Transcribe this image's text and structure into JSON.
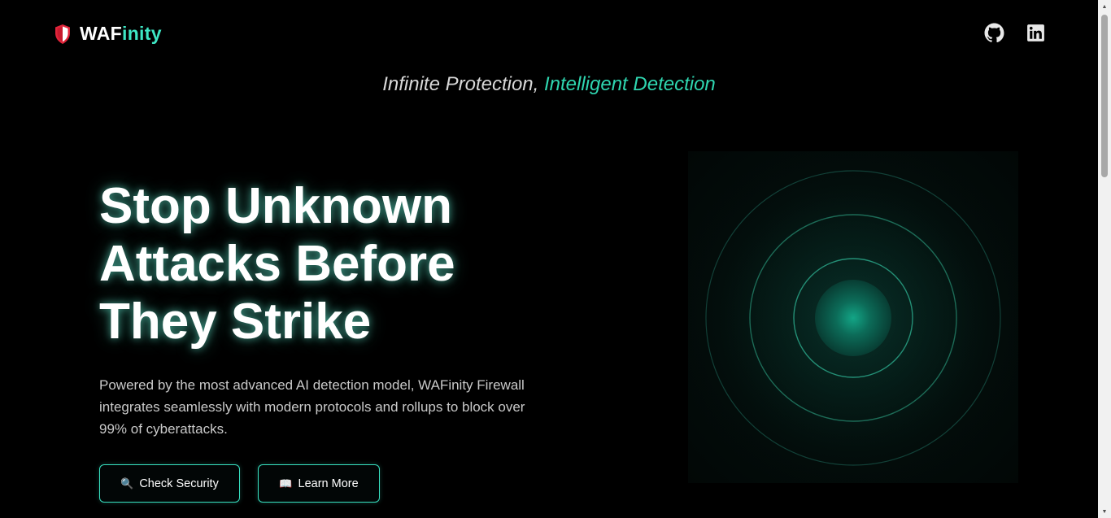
{
  "brand": {
    "name_part1": "WAF",
    "name_part2": "inity",
    "logo_icon": "shield-logo-icon"
  },
  "nav": {
    "icons": [
      "github-icon",
      "linkedin-icon"
    ]
  },
  "tagline": {
    "part1": "Infinite Protection, ",
    "part2": "Intelligent Detection"
  },
  "hero": {
    "title_lines": [
      "Stop Unknown",
      "Attacks Before",
      "They Strike"
    ],
    "description": "Powered by the most advanced AI detection model, WAFinity Firewall integrates seamlessly with modern protocols and rollups to block over 99% of cyberattacks.",
    "buttons": [
      {
        "icon": "🔍",
        "label": "Check Security"
      },
      {
        "icon": "📖",
        "label": "Learn More"
      }
    ]
  },
  "colors": {
    "accent": "#2fd6b0",
    "accent_bright": "#3ee6c4",
    "background": "#000000",
    "text_muted": "#c9c9c9",
    "logo_red": "#e0243a"
  }
}
